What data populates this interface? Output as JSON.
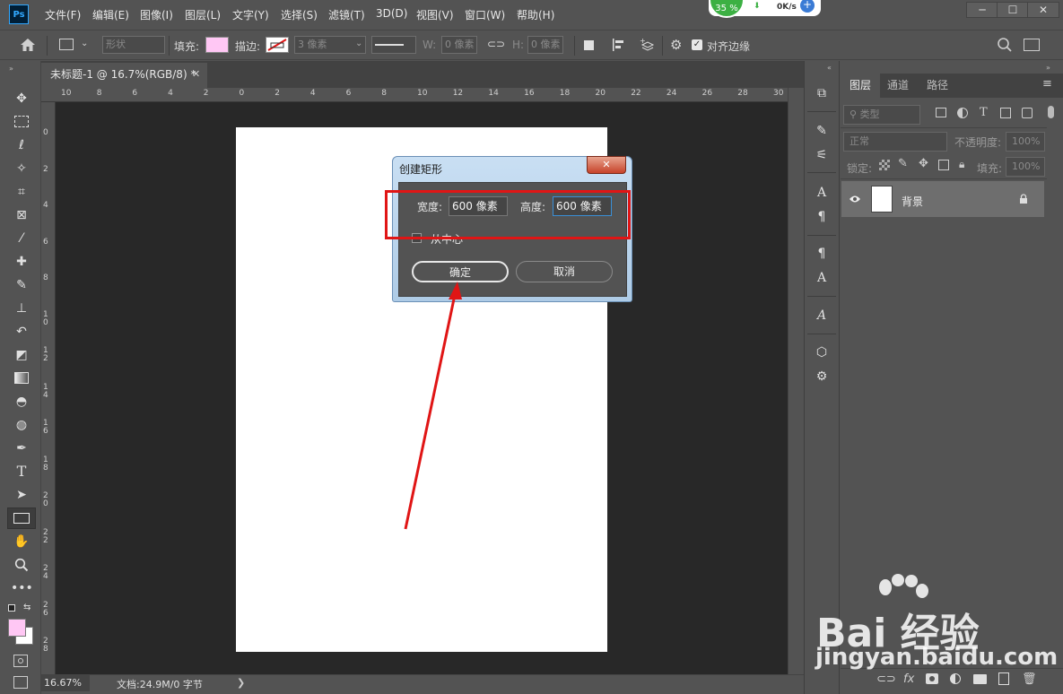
{
  "app": {
    "logo_text": "Ps",
    "menu": [
      "文件(F)",
      "编辑(E)",
      "图像(I)",
      "图层(L)",
      "文字(Y)",
      "选择(S)",
      "滤镜(T)",
      "3D(D)",
      "视图(V)",
      "窗口(W)",
      "帮助(H)"
    ],
    "window_buttons": [
      "─",
      "☐",
      "✕"
    ]
  },
  "net_widget": {
    "percent": "35 %",
    "speed": "0K/s",
    "down": "⬇",
    "plus": "+"
  },
  "options_bar": {
    "mode": "形状",
    "fill_label": "填充:",
    "fill_color": "#ffc7f4",
    "stroke_label": "描边:",
    "stroke_width": "3 像素",
    "w_label": "W:",
    "w_value": "0 像素",
    "h_label": "H:",
    "h_value": "0 像素",
    "align_edges_label": "对齐边缘"
  },
  "document": {
    "tab_title": "未标题-1 @ 16.7%(RGB/8) *",
    "tab_close": "✕",
    "zoom": "16.67%",
    "info": "文档:24.9M/0 字节",
    "status_arrow": "❯"
  },
  "rulers": {
    "top": [
      "10",
      "8",
      "6",
      "4",
      "2",
      "0",
      "2",
      "4",
      "6",
      "8",
      "10",
      "12",
      "14",
      "16",
      "18",
      "20",
      "22",
      "24",
      "26",
      "28",
      "30"
    ],
    "left": [
      "0",
      "2",
      "4",
      "6",
      "8",
      "1 0",
      "1 2",
      "1 4",
      "1 6",
      "1 8",
      "2 0",
      "2 2",
      "2 4",
      "2 6",
      "2 8"
    ]
  },
  "tools": [
    "move-icon",
    "marquee-icon",
    "lasso-icon",
    "magic-wand-icon",
    "crop-icon",
    "frame-icon",
    "eyedropper-icon",
    "healing-icon",
    "brush-icon",
    "stamp-icon",
    "history-brush-icon",
    "eraser-icon",
    "gradient-icon",
    "blur-icon",
    "dodge-icon",
    "pen-icon",
    "type-icon",
    "path-select-icon",
    "rectangle-icon",
    "hand-icon",
    "zoom-icon",
    "more-icon"
  ],
  "colors": {
    "foreground": "#ffc7f4",
    "background": "#ffffff",
    "accent_red": "#e01515"
  },
  "layers_panel": {
    "tabs": [
      "图层",
      "通道",
      "路径"
    ],
    "filter_placeholder": "类型",
    "blend_mode": "正常",
    "opacity_label": "不透明度:",
    "opacity_value": "100%",
    "lock_label": "锁定:",
    "fill_label": "填充:",
    "fill_value": "100%",
    "layer_name": "背景"
  },
  "dialog": {
    "title": "创建矩形",
    "width_label": "宽度:",
    "width_value": "600 像素",
    "height_label": "高度:",
    "height_value": "600 像素",
    "from_center_label": "从中心",
    "ok_label": "确定",
    "cancel_label": "取消"
  },
  "watermark": {
    "brand": "Bai  经验",
    "url": "jingyan.baidu.com"
  }
}
